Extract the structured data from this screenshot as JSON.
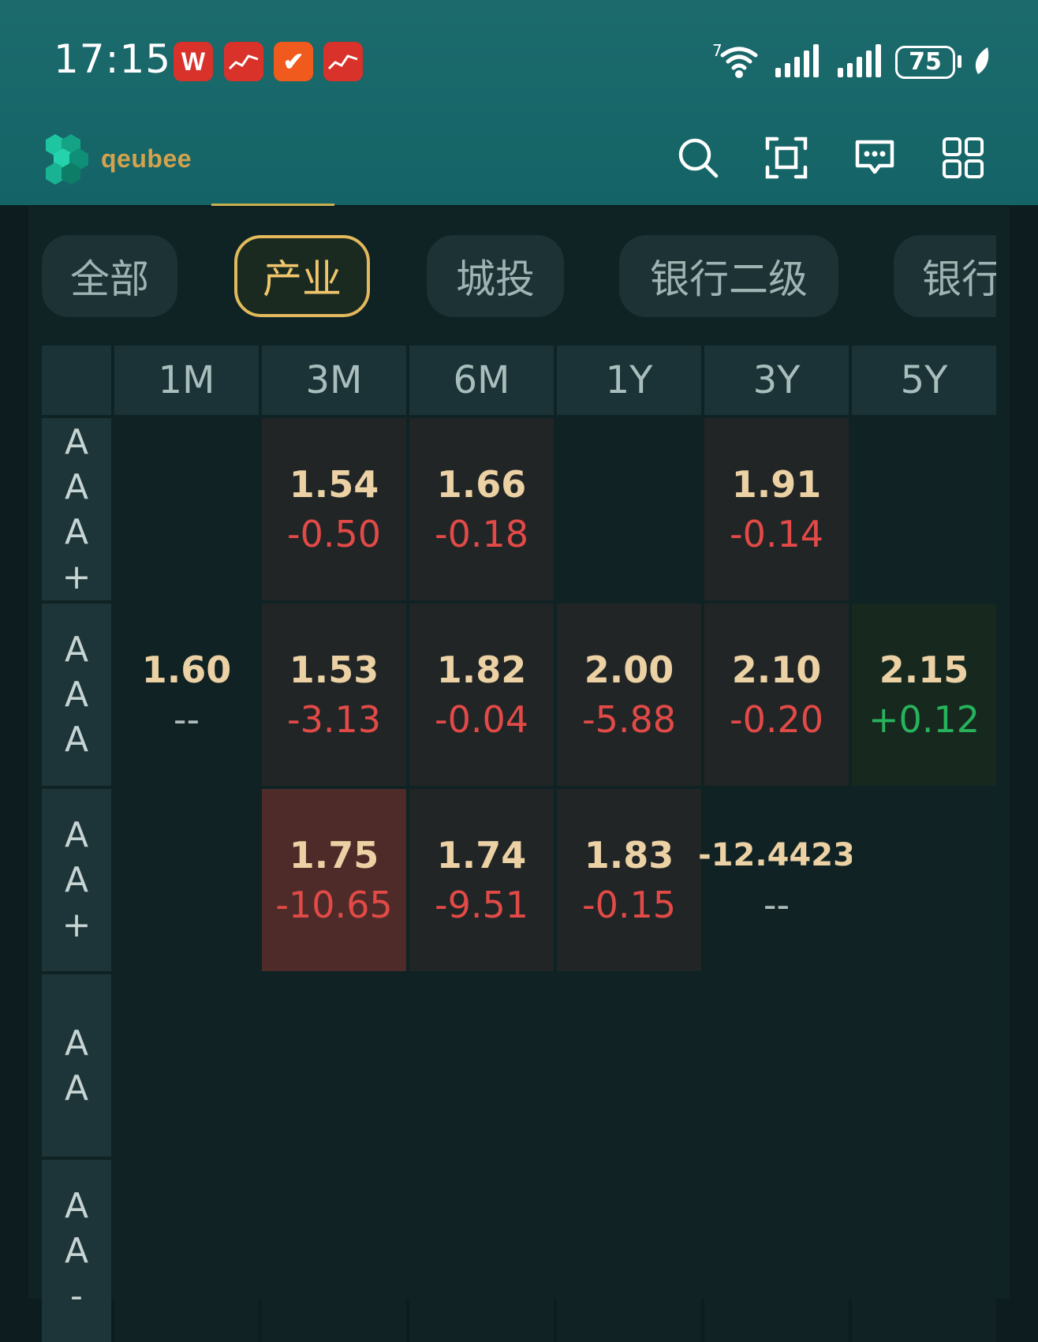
{
  "status_bar": {
    "time": "17:15",
    "apps": [
      {
        "name": "wps-app-icon",
        "glyph": "W",
        "color": "#d9322b"
      },
      {
        "name": "stock-chart-app-icon",
        "glyph": "",
        "color": "#d9322b"
      },
      {
        "name": "check-app-icon",
        "glyph": "✔",
        "color": "#f05a1c"
      },
      {
        "name": "stock-app-icon",
        "glyph": "",
        "color": "#d9322b"
      }
    ],
    "signal_tag": "7",
    "battery": "75"
  },
  "app_bar": {
    "logo_text": "qeubee",
    "icons": [
      "search-icon",
      "scan-icon",
      "message-icon",
      "grid-menu-icon"
    ]
  },
  "chips": [
    {
      "label": "全部",
      "active": false
    },
    {
      "label": "产业",
      "active": true
    },
    {
      "label": "城投",
      "active": false
    },
    {
      "label": "银行二级",
      "active": false
    },
    {
      "label": "银行",
      "active": false
    }
  ],
  "table": {
    "columns": [
      "1M",
      "3M",
      "6M",
      "1Y",
      "3Y",
      "5Y"
    ],
    "rows": [
      {
        "rating": [
          "A",
          "A",
          "A",
          "+"
        ],
        "cells": [
          null,
          {
            "value": "1.54",
            "change": "-0.50",
            "dir": "down",
            "shade": "filled"
          },
          {
            "value": "1.66",
            "change": "-0.18",
            "dir": "down",
            "shade": "filled"
          },
          null,
          {
            "value": "1.91",
            "change": "-0.14",
            "dir": "down",
            "shade": "filled"
          },
          null
        ]
      },
      {
        "rating": [
          "A",
          "A",
          "A"
        ],
        "cells": [
          {
            "value": "1.60",
            "change": "--",
            "dir": "none",
            "shade": "none"
          },
          {
            "value": "1.53",
            "change": "-3.13",
            "dir": "down",
            "shade": "filled"
          },
          {
            "value": "1.82",
            "change": "-0.04",
            "dir": "down",
            "shade": "filled"
          },
          {
            "value": "2.00",
            "change": "-5.88",
            "dir": "down",
            "shade": "filled"
          },
          {
            "value": "2.10",
            "change": "-0.20",
            "dir": "down",
            "shade": "filled"
          },
          {
            "value": "2.15",
            "change": "+0.12",
            "dir": "up",
            "shade": "pos"
          }
        ]
      },
      {
        "rating": [
          "A",
          "A",
          "+"
        ],
        "cells": [
          null,
          {
            "value": "1.75",
            "change": "-10.65",
            "dir": "down",
            "shade": "hot"
          },
          {
            "value": "1.74",
            "change": "-9.51",
            "dir": "down",
            "shade": "filled"
          },
          {
            "value": "1.83",
            "change": "-0.15",
            "dir": "down",
            "shade": "filled"
          },
          {
            "value": "-12.4423",
            "change": "--",
            "dir": "none",
            "shade": "none",
            "small": true
          },
          null
        ]
      },
      {
        "rating": [
          "A",
          "A"
        ],
        "cells": [
          null,
          null,
          null,
          null,
          null,
          null
        ]
      },
      {
        "rating": [
          "A",
          "A",
          "-"
        ],
        "cells": [
          null,
          null,
          null,
          null,
          null,
          null
        ]
      }
    ]
  }
}
